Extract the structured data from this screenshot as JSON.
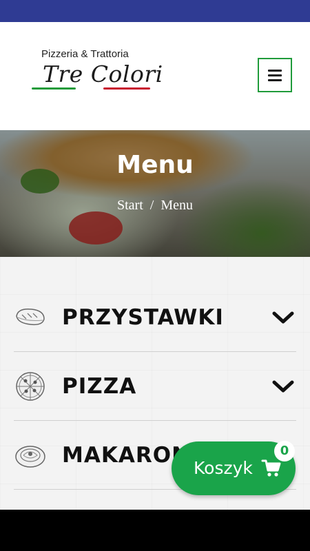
{
  "header": {
    "logo_subtitle": "Pizzeria & Trattoria",
    "logo_title": "Tre Colori",
    "logo_colors": {
      "green": "#1f9b3a",
      "red": "#c8102e"
    },
    "menu_icon": "hamburger-menu-icon"
  },
  "hero": {
    "title": "Menu",
    "breadcrumb": {
      "home": "Start",
      "separator": "/",
      "current": "Menu"
    }
  },
  "categories": [
    {
      "label": "PRZYSTAWKI",
      "icon": "bread-icon"
    },
    {
      "label": "PIZZA",
      "icon": "pizza-icon"
    },
    {
      "label": "MAKARONY",
      "icon": "pasta-icon"
    }
  ],
  "cart": {
    "label": "Koszyk",
    "count": "0",
    "icon": "shopping-cart-icon"
  },
  "colors": {
    "status_bar": "#2f3b93",
    "accent_green": "#1aa44a"
  }
}
